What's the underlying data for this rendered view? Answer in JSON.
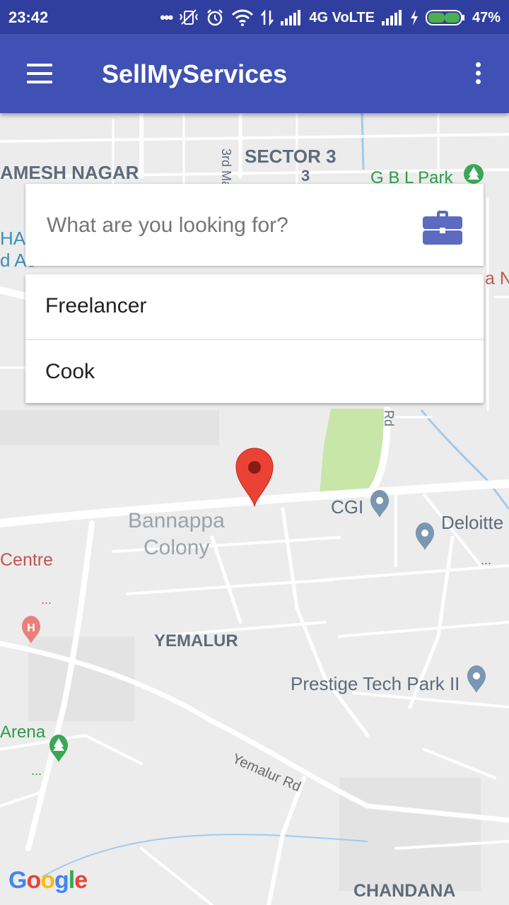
{
  "status_bar": {
    "time": "23:42",
    "network": "4G VoLTE",
    "battery": "47%",
    "icons": [
      "more-dots-icon",
      "vibrate-off-icon",
      "alarm-icon",
      "wifi-icon",
      "signal-icon",
      "battery-icon"
    ]
  },
  "app_bar": {
    "title": "SellMyServices",
    "menu_icon": "hamburger-menu-icon",
    "overflow_icon": "overflow-menu-icon",
    "color": "#3f51b5",
    "status_color": "#303f9f"
  },
  "search": {
    "placeholder": "What are you looking for?",
    "value": "",
    "icon": "briefcase-icon",
    "icon_color": "#5c6bc0"
  },
  "suggestions": [
    {
      "label": "Freelancer"
    },
    {
      "label": "Cook"
    }
  ],
  "map": {
    "labels": {
      "sector3": "SECTOR 3",
      "sector3_sub": "3",
      "ramesh_nagar": "AMESH NAGAR",
      "third_main": "3rd Ma",
      "gbl_park": "G B L Park",
      "ha": "HA",
      "dac": "d Ac",
      "na_n": "a N",
      "rd": "Rd",
      "cgi": "CGI",
      "deloitte": "Deloitte",
      "bannappa": "Bannappa",
      "colony": "Colony",
      "centre": "Centre",
      "yemalur": "YEMALUR",
      "prestige": "Prestige Tech Park II",
      "arena": "Arena",
      "yemalur_rd": "Yemalur Rd",
      "chandana": "CHANDANA",
      "dots1": "...",
      "dots2": "...",
      "dots3": "..."
    },
    "marker_color": "#ea4335",
    "park_color": "#c8e6a8",
    "google_logo": "Google"
  }
}
